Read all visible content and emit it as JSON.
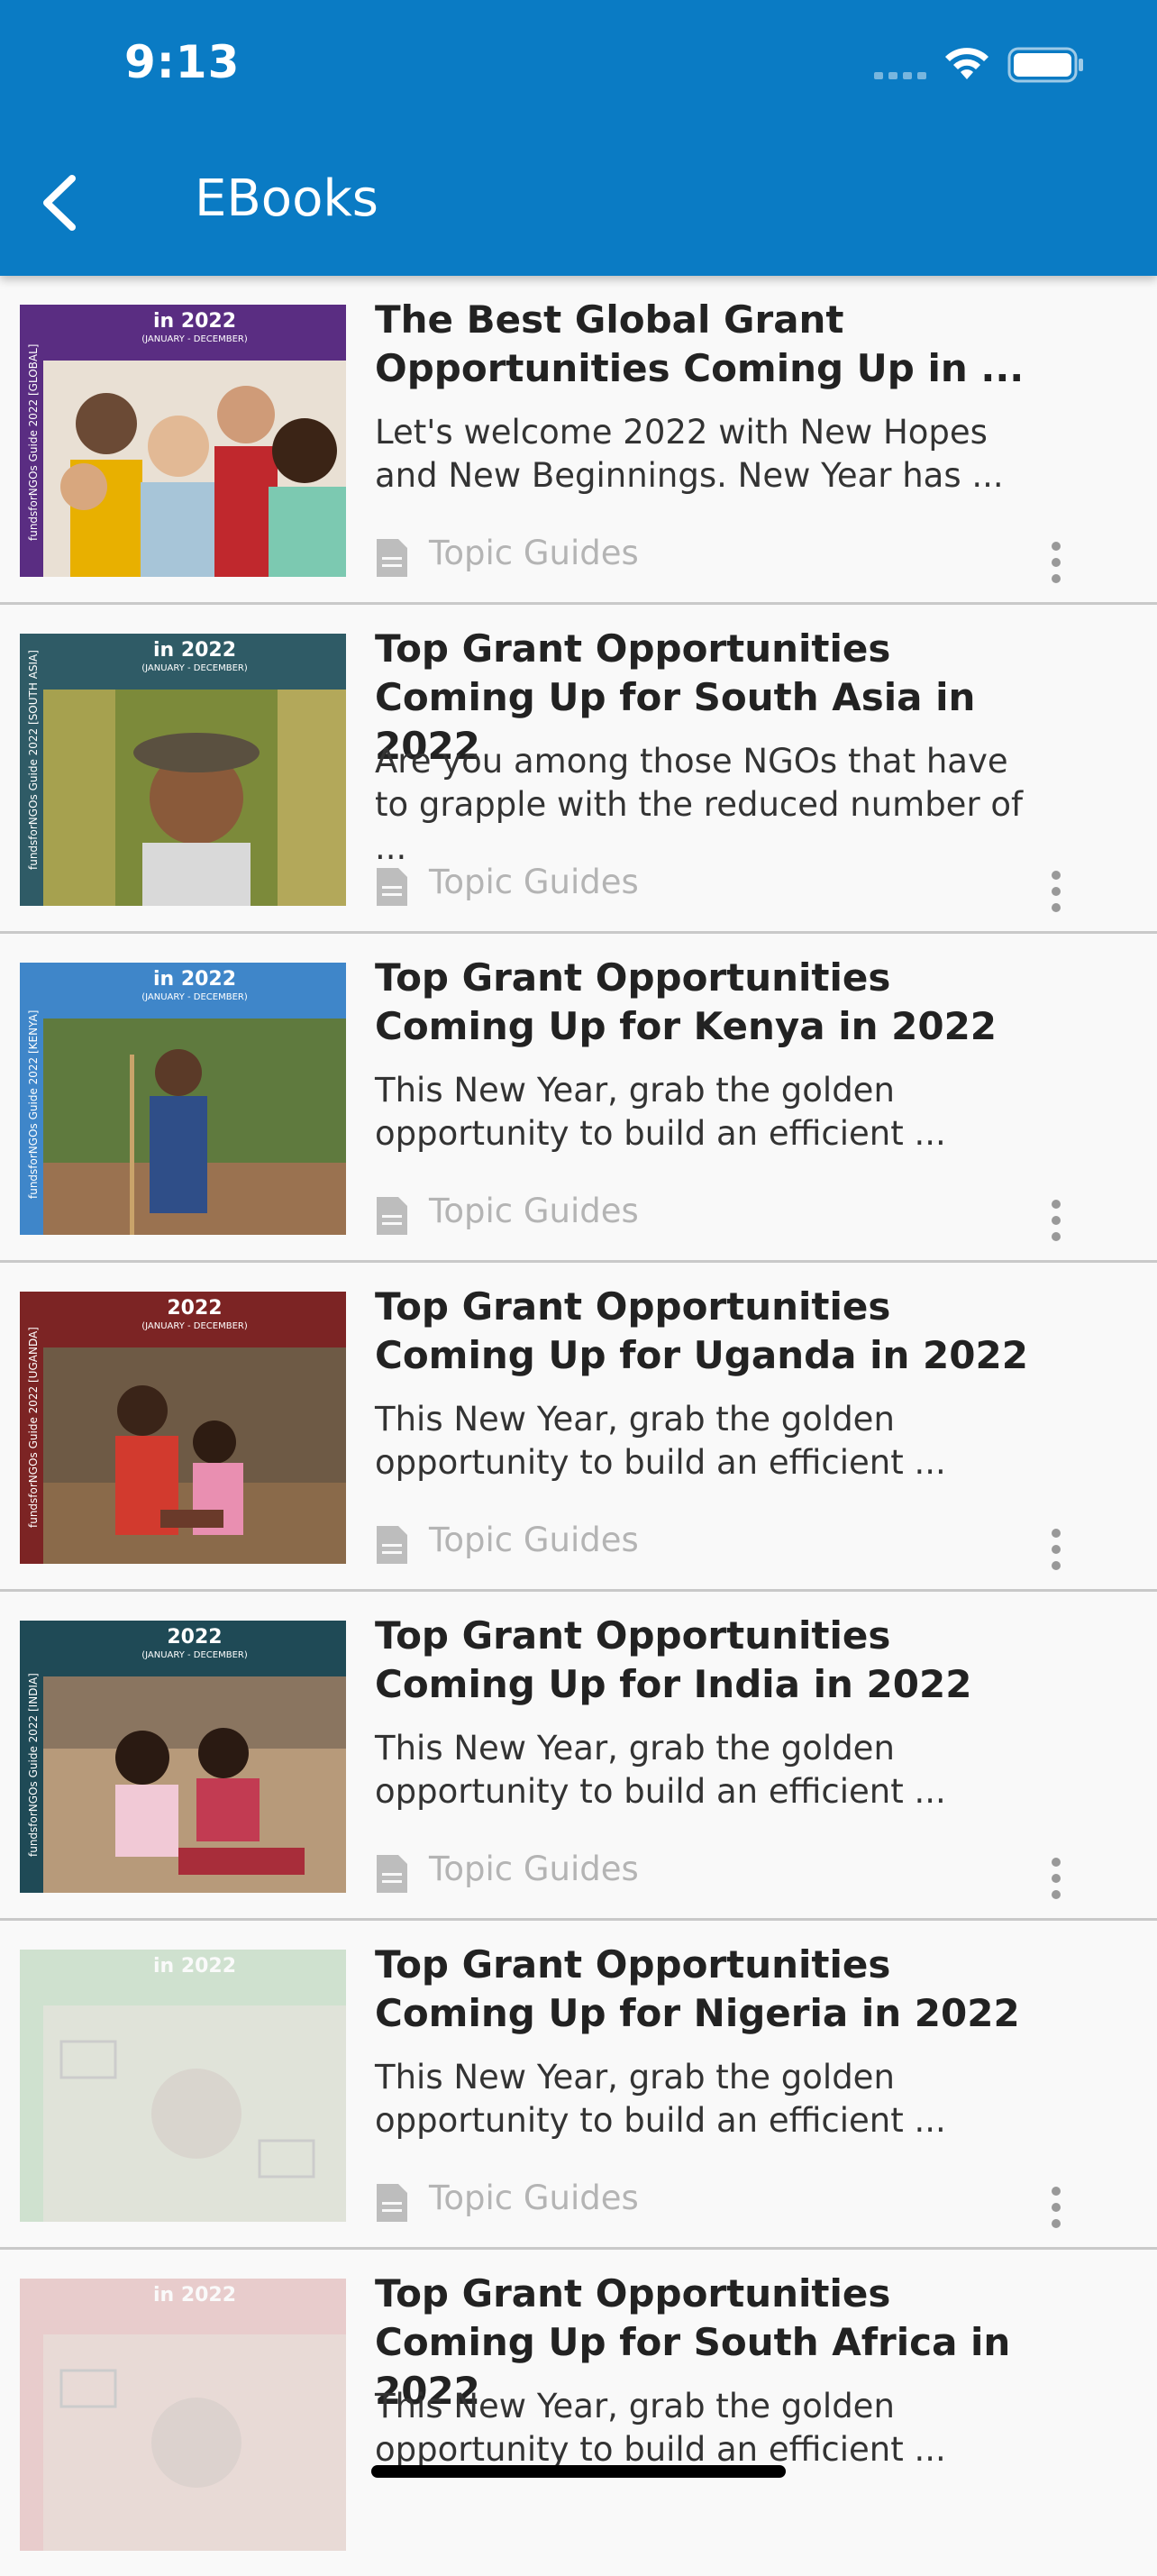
{
  "status_bar": {
    "time": "9:13"
  },
  "header": {
    "title": "EBooks"
  },
  "items": [
    {
      "title": "The Best Global Grant Opportunities Coming Up in ...",
      "description": "Let's welcome 2022 with New Hopes and New Beginnings. New Year has ...",
      "category": "Topic Guides",
      "cover_band": "in 2022",
      "cover_dates": "(JANUARY - DECEMBER)",
      "cover_spine": "fundsforNGOs Guide 2022 [GLOBAL]",
      "cover_color": "#5a2d82"
    },
    {
      "title": "Top Grant Opportunities Coming Up for South Asia in 2022",
      "description": "Are you among those NGOs that have to grapple with the reduced number of ...",
      "category": "Topic Guides",
      "cover_band": "in 2022",
      "cover_dates": "(JANUARY - DECEMBER)",
      "cover_spine": "fundsforNGOs Guide 2022 [SOUTH ASIA]",
      "cover_color": "#2f5b66"
    },
    {
      "title": "Top Grant Opportunities Coming Up for Kenya in 2022",
      "description": "This New Year, grab the golden opportunity to build an efficient ...",
      "category": "Topic Guides",
      "cover_band": "in 2022",
      "cover_dates": "(JANUARY - DECEMBER)",
      "cover_spine": "fundsforNGOs Guide 2022 [KENYA]",
      "cover_color": "#3f86c9"
    },
    {
      "title": "Top Grant Opportunities Coming Up for Uganda in 2022",
      "description": "This New Year, grab the golden opportunity to build an efficient ...",
      "category": "Topic Guides",
      "cover_band": "2022",
      "cover_dates": "(JANUARY - DECEMBER)",
      "cover_spine": "fundsforNGOs Guide 2022 [UGANDA]",
      "cover_color": "#7c2424"
    },
    {
      "title": "Top Grant Opportunities Coming Up for India in 2022",
      "description": "This New Year, grab the golden opportunity to build an efficient ...",
      "category": "Topic Guides",
      "cover_band": "2022",
      "cover_dates": "(JANUARY - DECEMBER)",
      "cover_spine": "fundsforNGOs Guide 2022 [INDIA]",
      "cover_color": "#1f4a56"
    },
    {
      "title": "Top Grant Opportunities Coming Up for Nigeria in 2022",
      "description": "This New Year, grab the golden opportunity to build an efficient ...",
      "category": "Topic Guides",
      "cover_band": "in 2022",
      "cover_dates": "",
      "cover_spine": "",
      "cover_color": "#3e8e3e"
    },
    {
      "title": "Top Grant Opportunities Coming Up for South Africa in 2022",
      "description": "This New Year, grab the golden opportunity to build an efficient ...",
      "category": "",
      "cover_band": "in 2022",
      "cover_dates": "",
      "cover_spine": "",
      "cover_color": "#b03030"
    }
  ],
  "colors": {
    "header": "#0a7bc4"
  }
}
